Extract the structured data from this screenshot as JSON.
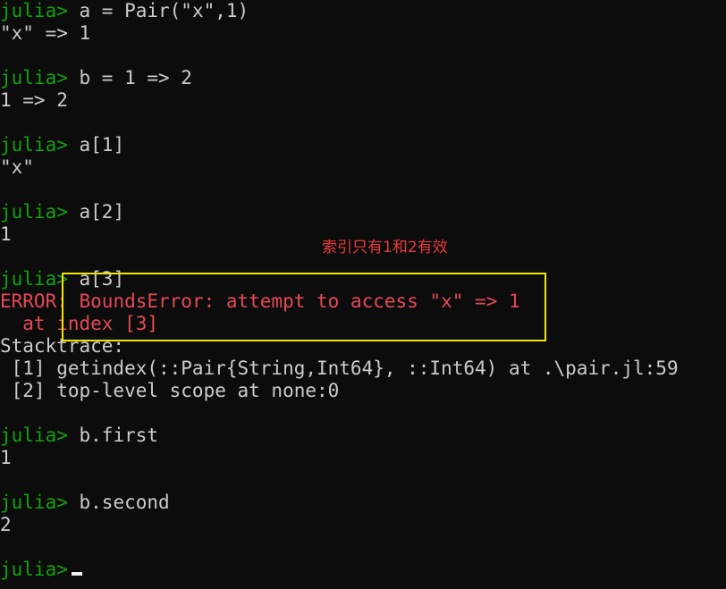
{
  "terminal": {
    "prompt": "julia>",
    "lines": {
      "l1_cmd": "a = Pair(\"x\",1)",
      "l1_out": "\"x\" => 1",
      "l2_cmd": "b = 1 => 2",
      "l2_out": "1 => 2",
      "l3_cmd": "a[1]",
      "l3_out": "\"x\"",
      "l4_cmd": "a[2]",
      "l4_out": "1",
      "l5_cmd": "a[3]",
      "err_label": "ERROR:",
      "err_msg": "BoundsError: attempt to access \"x\" => 1",
      "err_msg2": "  at index [3]",
      "stacktrace": "Stacktrace:",
      "st1": " [1] getindex(::Pair{String,Int64}, ::Int64) at .\\pair.jl:59",
      "st2": " [2] top-level scope at none:0",
      "l6_cmd": "b.first",
      "l6_out": "1",
      "l7_cmd": "b.second",
      "l7_out": "2"
    }
  },
  "annotation": {
    "text": "索引只有1和2有效"
  },
  "colors": {
    "background": "#0c0c0c",
    "prompt": "#13a10e",
    "text": "#cccccc",
    "error": "#e74856",
    "annotation": "#e83a3a",
    "highlight_box": "#f2e600"
  }
}
